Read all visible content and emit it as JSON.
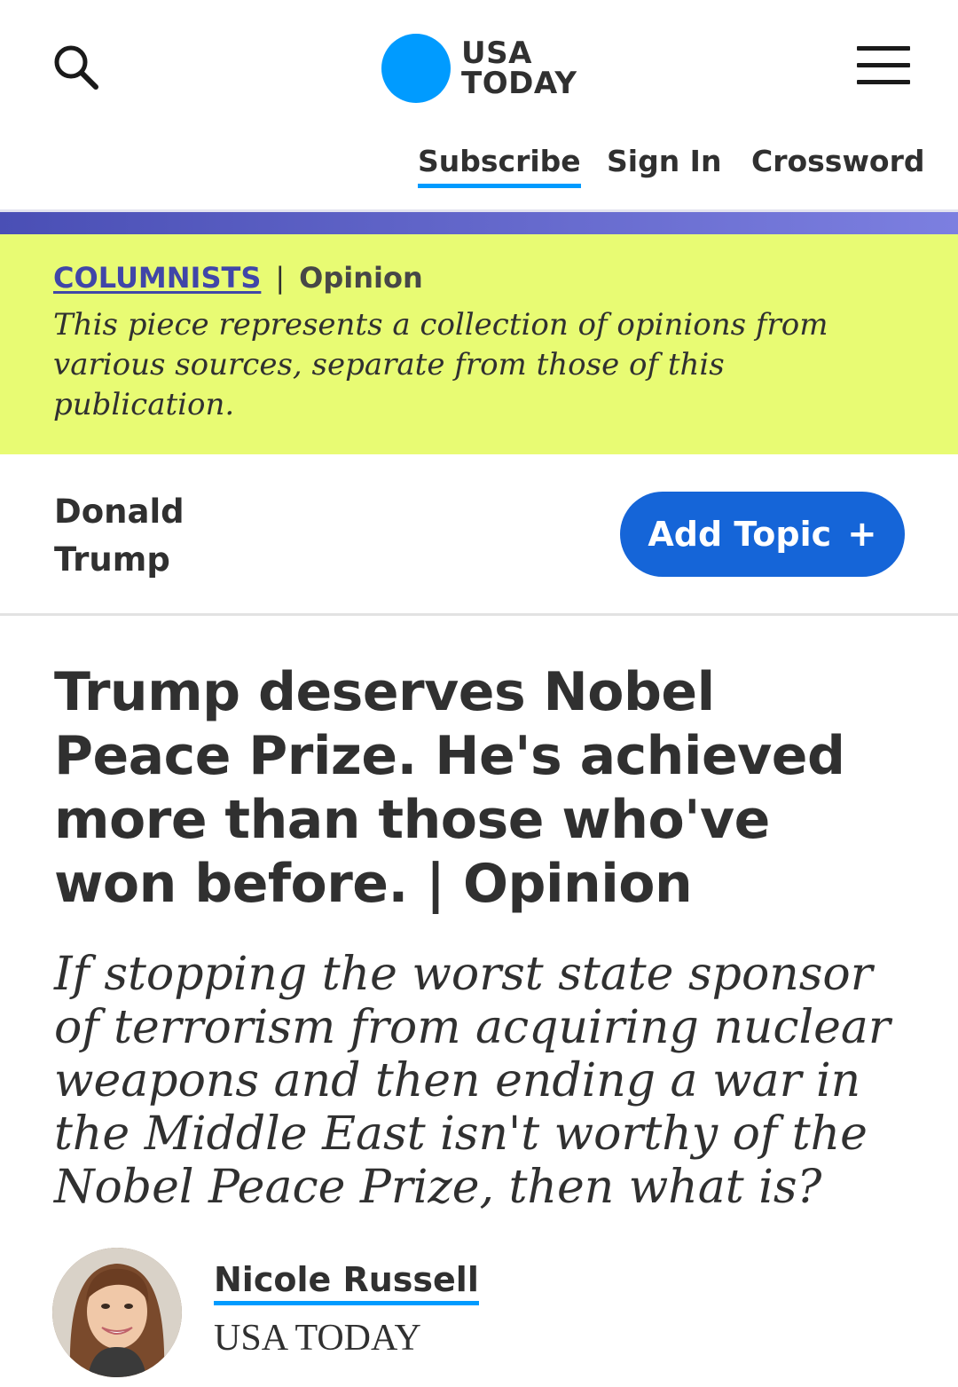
{
  "header": {
    "logo_line1": "USA",
    "logo_line2": "TODAY",
    "nav": {
      "subscribe": "Subscribe",
      "sign_in": "Sign In",
      "crossword": "Crossword"
    }
  },
  "banner": {
    "section_link": "COLUMNISTS",
    "separator": "|",
    "section_label": "Opinion",
    "disclaimer": "This piece represents a collection of opinions from various sources, separate from those of this publication."
  },
  "topic": {
    "name": "Donald Trump",
    "add_button_label": "Add Topic",
    "add_button_symbol": "+"
  },
  "article": {
    "headline": "Trump deserves Nobel Peace Prize. He's achieved more than those who've won before. | Opinion",
    "subheadline": "If stopping the worst state sponsor of terrorism from acquiring nuclear weapons and then ending a war in the Middle East isn't worthy of the Nobel Peace Prize, then what is?"
  },
  "author": {
    "name": "Nicole Russell",
    "organization": "USA TODAY"
  },
  "colors": {
    "logo_blue": "#009bff",
    "banner_yellow": "#e8fb73",
    "button_blue": "#1565d8",
    "link_purple": "#4046a8"
  }
}
